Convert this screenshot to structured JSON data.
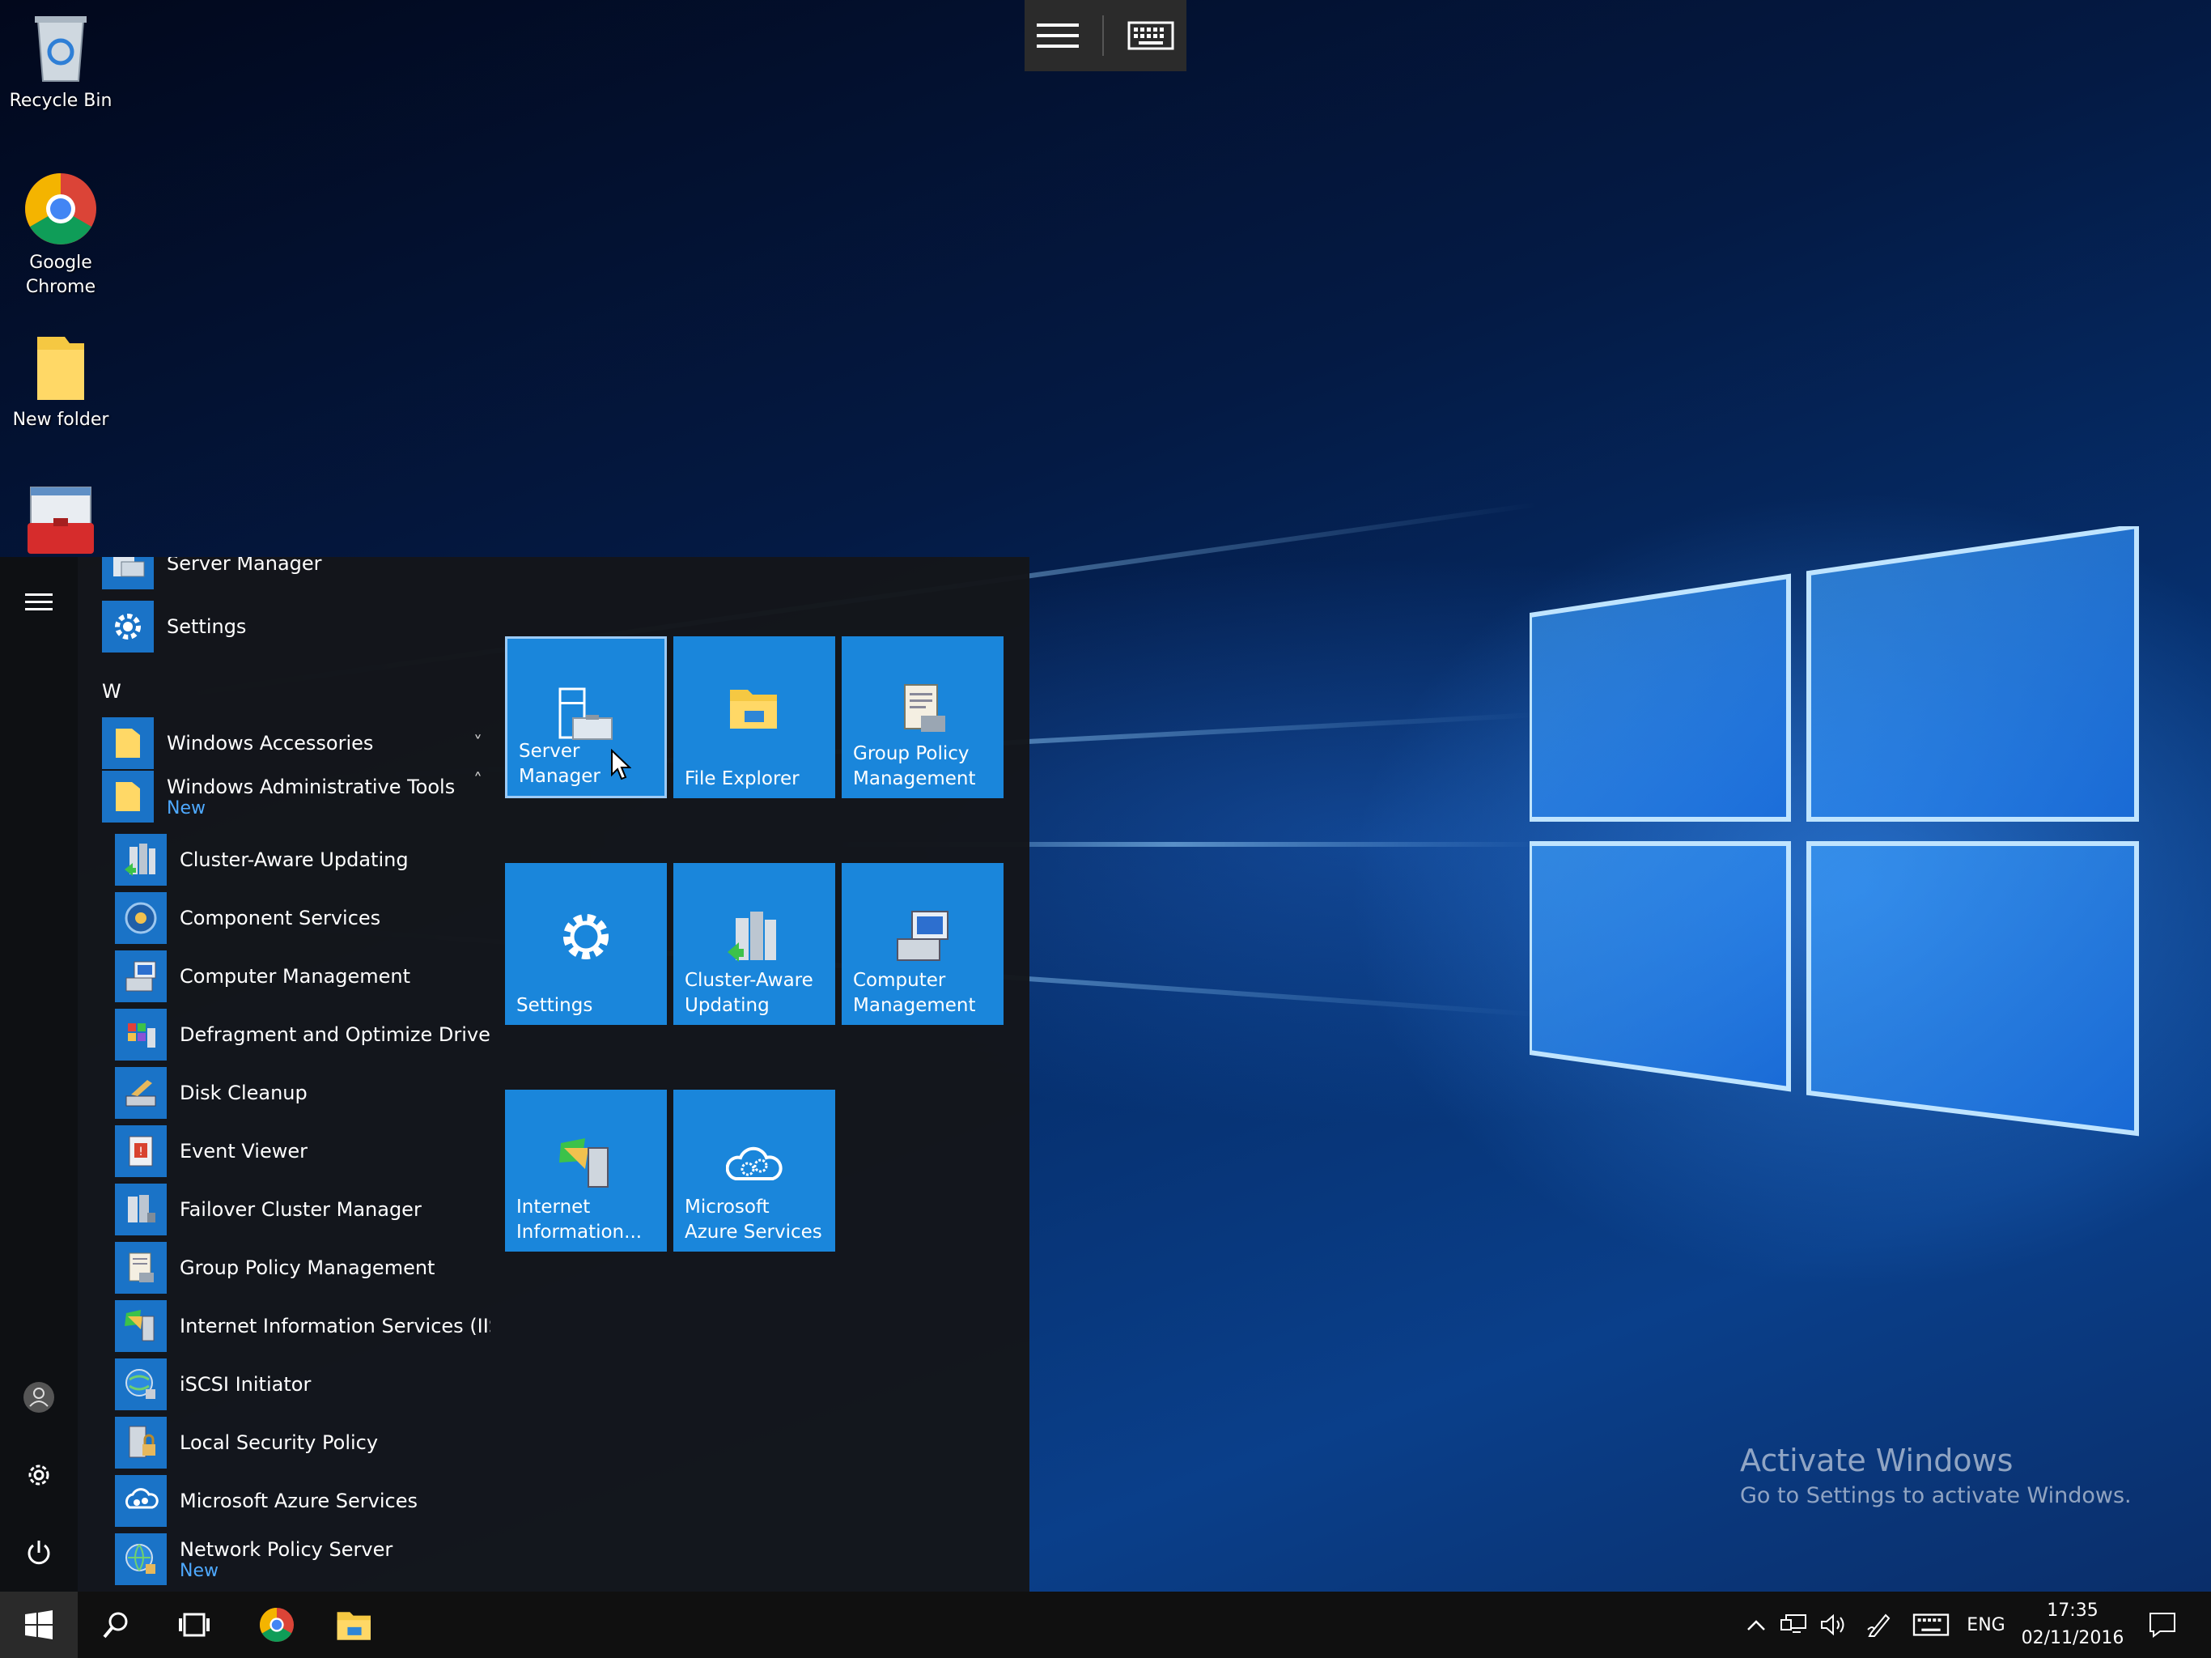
{
  "desktop": {
    "icons": [
      {
        "label": "Recycle Bin",
        "icon": "recycle-bin-icon"
      },
      {
        "label": "Google Chrome",
        "icon": "chrome-icon"
      },
      {
        "label": "New folder",
        "icon": "folder-icon"
      },
      {
        "label": "",
        "icon": "toolbox-icon"
      }
    ],
    "watermark": {
      "title": "Activate Windows",
      "subtitle": "Go to Settings to activate Windows."
    }
  },
  "top_toolbar": {
    "menu_icon": "hamburger-icon",
    "keyboard_icon": "keyboard-icon"
  },
  "start_menu": {
    "rail": {
      "menu_icon": "hamburger-icon",
      "user_icon": "user-icon",
      "settings_icon": "gear-icon",
      "power_icon": "power-icon"
    },
    "app_list": {
      "top_items": [
        {
          "label": "Server Manager",
          "icon": "server-manager-icon"
        },
        {
          "label": "Settings",
          "icon": "gear-icon"
        }
      ],
      "letter": "W",
      "groups": [
        {
          "label": "Windows Accessories",
          "sub": "",
          "icon": "folder-icon",
          "chevron": "˅"
        },
        {
          "label": "Windows Administrative Tools",
          "sub": "New",
          "icon": "folder-icon",
          "chevron": "˄"
        }
      ],
      "admin_tools": [
        {
          "label": "Cluster-Aware Updating",
          "sub": ""
        },
        {
          "label": "Component Services",
          "sub": ""
        },
        {
          "label": "Computer Management",
          "sub": ""
        },
        {
          "label": "Defragment and Optimize Drives",
          "sub": ""
        },
        {
          "label": "Disk Cleanup",
          "sub": ""
        },
        {
          "label": "Event Viewer",
          "sub": ""
        },
        {
          "label": "Failover Cluster Manager",
          "sub": ""
        },
        {
          "label": "Group Policy Management",
          "sub": ""
        },
        {
          "label": "Internet Information Services (IIS...",
          "sub": ""
        },
        {
          "label": "iSCSI Initiator",
          "sub": ""
        },
        {
          "label": "Local Security Policy",
          "sub": ""
        },
        {
          "label": "Microsoft Azure Services",
          "sub": ""
        },
        {
          "label": "Network Policy Server",
          "sub": "New"
        }
      ]
    },
    "tiles": [
      {
        "label_1": "Server Manager",
        "label_2": "",
        "icon": "server-manager-icon",
        "selected": true
      },
      {
        "label_1": "File Explorer",
        "label_2": "",
        "icon": "file-explorer-icon"
      },
      {
        "label_1": "Group Policy",
        "label_2": "Management",
        "icon": "group-policy-icon"
      },
      {
        "label_1": "Settings",
        "label_2": "",
        "icon": "gear-icon"
      },
      {
        "label_1": "Cluster-Aware",
        "label_2": "Updating",
        "icon": "cluster-icon"
      },
      {
        "label_1": "Computer",
        "label_2": "Management",
        "icon": "computer-management-icon"
      },
      {
        "label_1": "Internet",
        "label_2": "Information...",
        "icon": "iis-icon"
      },
      {
        "label_1": "Microsoft",
        "label_2": "Azure Services",
        "icon": "azure-icon"
      }
    ]
  },
  "taskbar": {
    "start_icon": "windows-start-icon",
    "search_icon": "search-icon",
    "task_view_icon": "task-view-icon",
    "pinned": [
      "chrome-icon",
      "file-explorer-icon"
    ],
    "tray": {
      "language": "ENG",
      "time": "17:35",
      "date": "02/11/2016"
    }
  },
  "colors": {
    "tile_blue": "#1a86db",
    "icon_blue": "#1a73c7",
    "new_badge": "#4ea9ff",
    "start_bg": "#14161a",
    "taskbar_bg": "#101010"
  }
}
